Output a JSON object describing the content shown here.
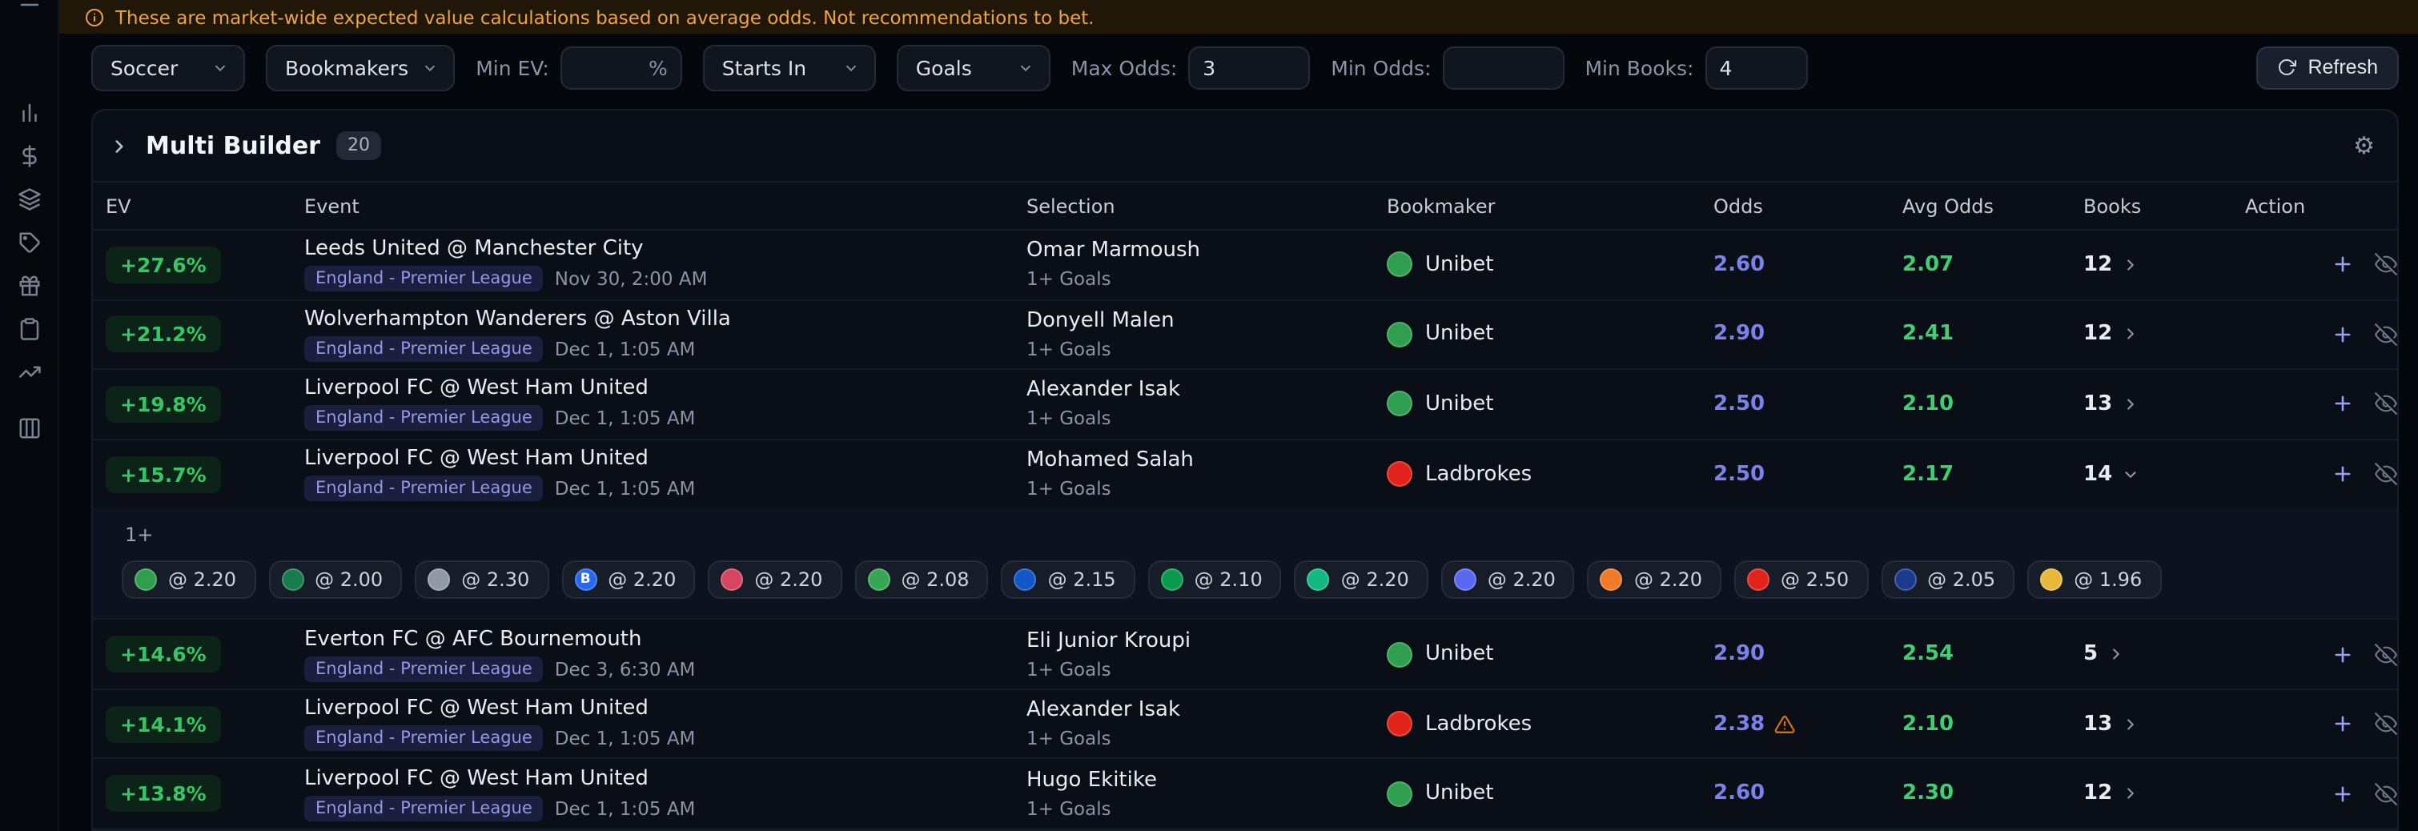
{
  "banner": {
    "text": "These are market-wide expected value calculations based on average odds. Not recommendations to bet."
  },
  "filters": {
    "sport": {
      "value": "Soccer"
    },
    "bookmakers": {
      "value": "Bookmakers"
    },
    "min_ev": {
      "label": "Min EV:",
      "value": "",
      "suffix": "%"
    },
    "starts_in": {
      "value": "Starts In"
    },
    "market": {
      "value": "Goals"
    },
    "max_odds": {
      "label": "Max Odds:",
      "value": "3"
    },
    "min_odds": {
      "label": "Min Odds:",
      "value": ""
    },
    "min_books": {
      "label": "Min Books:",
      "value": "4"
    },
    "refresh": {
      "label": "Refresh"
    }
  },
  "builder": {
    "title": "Multi Builder",
    "count": "20"
  },
  "table": {
    "columns": {
      "ev": "EV",
      "event": "Event",
      "selection": "Selection",
      "bookmaker": "Bookmaker",
      "odds": "Odds",
      "avg_odds": "Avg Odds",
      "books": "Books",
      "action": "Action"
    },
    "rows": [
      {
        "ev": "+27.6%",
        "event": "Leeds United @ Manchester City",
        "league": "England - Premier League",
        "date": "Nov 30, 2:00 AM",
        "selection": "Omar Marmoush",
        "market": "1+ Goals",
        "bookmaker": "Unibet",
        "bookmaker_color": "#2f9e4f",
        "odds": "2.60",
        "avg_odds": "2.07",
        "books": "12"
      },
      {
        "ev": "+21.2%",
        "event": "Wolverhampton Wanderers @ Aston Villa",
        "league": "England - Premier League",
        "date": "Dec 1, 1:05 AM",
        "selection": "Donyell Malen",
        "market": "1+ Goals",
        "bookmaker": "Unibet",
        "bookmaker_color": "#2f9e4f",
        "odds": "2.90",
        "avg_odds": "2.41",
        "books": "12"
      },
      {
        "ev": "+19.8%",
        "event": "Liverpool FC @ West Ham United",
        "league": "England - Premier League",
        "date": "Dec 1, 1:05 AM",
        "selection": "Alexander Isak",
        "market": "1+ Goals",
        "bookmaker": "Unibet",
        "bookmaker_color": "#2f9e4f",
        "odds": "2.50",
        "avg_odds": "2.10",
        "books": "13"
      },
      {
        "ev": "+15.7%",
        "event": "Liverpool FC @ West Ham United",
        "league": "England - Premier League",
        "date": "Dec 1, 1:05 AM",
        "selection": "Mohamed Salah",
        "market": "1+ Goals",
        "bookmaker": "Ladbrokes",
        "bookmaker_color": "#e2231a",
        "odds": "2.50",
        "avg_odds": "2.17",
        "books": "14",
        "expanded": true
      },
      {
        "ev": "+14.6%",
        "event": "Everton FC @ AFC Bournemouth",
        "league": "England - Premier League",
        "date": "Dec 3, 6:30 AM",
        "selection": "Eli Junior Kroupi",
        "market": "1+ Goals",
        "bookmaker": "Unibet",
        "bookmaker_color": "#2f9e4f",
        "odds": "2.90",
        "avg_odds": "2.54",
        "books": "5"
      },
      {
        "ev": "+14.1%",
        "event": "Liverpool FC @ West Ham United",
        "league": "England - Premier League",
        "date": "Dec 1, 1:05 AM",
        "selection": "Alexander Isak",
        "market": "1+ Goals",
        "bookmaker": "Ladbrokes",
        "bookmaker_color": "#e2231a",
        "odds": "2.38",
        "warning": true,
        "avg_odds": "2.10",
        "books": "13"
      },
      {
        "ev": "+13.8%",
        "event": "Liverpool FC @ West Ham United",
        "league": "England - Premier League",
        "date": "Dec 1, 1:05 AM",
        "selection": "Hugo Ekitike",
        "market": "1+ Goals",
        "bookmaker": "Unibet",
        "bookmaker_color": "#2f9e4f",
        "odds": "2.60",
        "avg_odds": "2.30",
        "books": "12"
      }
    ]
  },
  "expansion": {
    "market_label": "1+",
    "chips": [
      {
        "label": "@ 2.20",
        "color": "#2f9e4f",
        "letter": ""
      },
      {
        "label": "@ 2.00",
        "color": "#177b4b",
        "letter": ""
      },
      {
        "label": "@ 2.30",
        "color": "#8f98a3",
        "letter": ""
      },
      {
        "label": "@ 2.20",
        "color": "#2468f2",
        "letter": "B"
      },
      {
        "label": "@ 2.20",
        "color": "#d64561",
        "letter": ""
      },
      {
        "label": "@ 2.08",
        "color": "#35a653",
        "letter": ""
      },
      {
        "label": "@ 2.15",
        "color": "#1256c9",
        "letter": ""
      },
      {
        "label": "@ 2.10",
        "color": "#0a9a4e",
        "letter": ""
      },
      {
        "label": "@ 2.20",
        "color": "#10b981",
        "letter": ""
      },
      {
        "label": "@ 2.20",
        "color": "#5b67f0",
        "letter": ""
      },
      {
        "label": "@ 2.20",
        "color": "#f07a28",
        "letter": ""
      },
      {
        "label": "@ 2.50",
        "color": "#e2231a",
        "letter": ""
      },
      {
        "label": "@ 2.05",
        "color": "#1b3a8f",
        "letter": ""
      },
      {
        "label": "@ 1.96",
        "color": "#e8b83a",
        "letter": ""
      }
    ]
  }
}
